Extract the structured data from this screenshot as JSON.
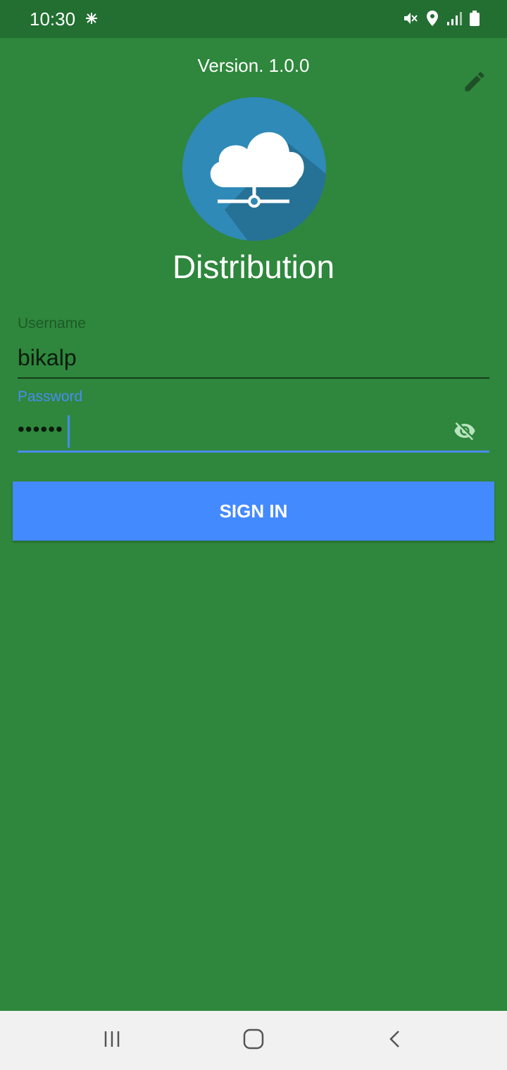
{
  "status_bar": {
    "time": "10:30",
    "left_icon": "snowflake-like-status-icon",
    "right_icons": [
      "vibrate-mute-icon",
      "location-pin-icon",
      "signal-icon",
      "battery-icon"
    ]
  },
  "header": {
    "version_text": "Version. 1.0.0",
    "edit_icon": "pencil-icon"
  },
  "branding": {
    "logo_icon": "cloud-network-icon",
    "app_name": "Distribution",
    "logo_circle_color": "#2f8ab8"
  },
  "form": {
    "username": {
      "label": "Username",
      "value": "bikalp"
    },
    "password": {
      "label": "Password",
      "value": "••••••",
      "toggle_icon": "visibility-off-icon"
    }
  },
  "actions": {
    "sign_in_label": "SIGN IN"
  },
  "nav_bar": {
    "icons": [
      "recent-apps-icon",
      "home-icon",
      "back-icon"
    ]
  },
  "colors": {
    "background": "#2e873c",
    "status_bar": "#226f31",
    "accent": "#448aff",
    "focus": "#4a8bf5"
  }
}
